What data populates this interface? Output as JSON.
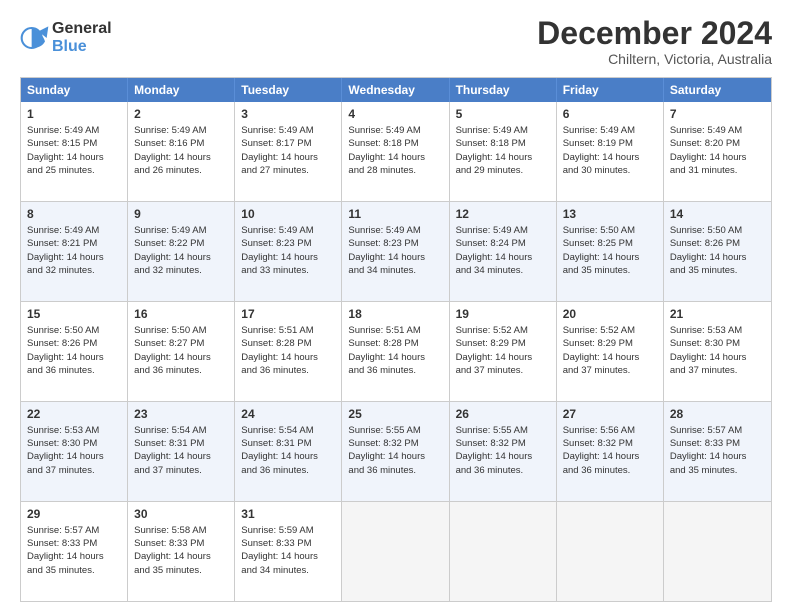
{
  "logo": {
    "general": "General",
    "blue": "Blue"
  },
  "title": "December 2024",
  "location": "Chiltern, Victoria, Australia",
  "days_of_week": [
    "Sunday",
    "Monday",
    "Tuesday",
    "Wednesday",
    "Thursday",
    "Friday",
    "Saturday"
  ],
  "weeks": [
    [
      {
        "day": "1",
        "sunrise": "Sunrise: 5:49 AM",
        "sunset": "Sunset: 8:15 PM",
        "daylight": "Daylight: 14 hours and 25 minutes."
      },
      {
        "day": "2",
        "sunrise": "Sunrise: 5:49 AM",
        "sunset": "Sunset: 8:16 PM",
        "daylight": "Daylight: 14 hours and 26 minutes."
      },
      {
        "day": "3",
        "sunrise": "Sunrise: 5:49 AM",
        "sunset": "Sunset: 8:17 PM",
        "daylight": "Daylight: 14 hours and 27 minutes."
      },
      {
        "day": "4",
        "sunrise": "Sunrise: 5:49 AM",
        "sunset": "Sunset: 8:18 PM",
        "daylight": "Daylight: 14 hours and 28 minutes."
      },
      {
        "day": "5",
        "sunrise": "Sunrise: 5:49 AM",
        "sunset": "Sunset: 8:18 PM",
        "daylight": "Daylight: 14 hours and 29 minutes."
      },
      {
        "day": "6",
        "sunrise": "Sunrise: 5:49 AM",
        "sunset": "Sunset: 8:19 PM",
        "daylight": "Daylight: 14 hours and 30 minutes."
      },
      {
        "day": "7",
        "sunrise": "Sunrise: 5:49 AM",
        "sunset": "Sunset: 8:20 PM",
        "daylight": "Daylight: 14 hours and 31 minutes."
      }
    ],
    [
      {
        "day": "8",
        "sunrise": "Sunrise: 5:49 AM",
        "sunset": "Sunset: 8:21 PM",
        "daylight": "Daylight: 14 hours and 32 minutes."
      },
      {
        "day": "9",
        "sunrise": "Sunrise: 5:49 AM",
        "sunset": "Sunset: 8:22 PM",
        "daylight": "Daylight: 14 hours and 32 minutes."
      },
      {
        "day": "10",
        "sunrise": "Sunrise: 5:49 AM",
        "sunset": "Sunset: 8:23 PM",
        "daylight": "Daylight: 14 hours and 33 minutes."
      },
      {
        "day": "11",
        "sunrise": "Sunrise: 5:49 AM",
        "sunset": "Sunset: 8:23 PM",
        "daylight": "Daylight: 14 hours and 34 minutes."
      },
      {
        "day": "12",
        "sunrise": "Sunrise: 5:49 AM",
        "sunset": "Sunset: 8:24 PM",
        "daylight": "Daylight: 14 hours and 34 minutes."
      },
      {
        "day": "13",
        "sunrise": "Sunrise: 5:50 AM",
        "sunset": "Sunset: 8:25 PM",
        "daylight": "Daylight: 14 hours and 35 minutes."
      },
      {
        "day": "14",
        "sunrise": "Sunrise: 5:50 AM",
        "sunset": "Sunset: 8:26 PM",
        "daylight": "Daylight: 14 hours and 35 minutes."
      }
    ],
    [
      {
        "day": "15",
        "sunrise": "Sunrise: 5:50 AM",
        "sunset": "Sunset: 8:26 PM",
        "daylight": "Daylight: 14 hours and 36 minutes."
      },
      {
        "day": "16",
        "sunrise": "Sunrise: 5:50 AM",
        "sunset": "Sunset: 8:27 PM",
        "daylight": "Daylight: 14 hours and 36 minutes."
      },
      {
        "day": "17",
        "sunrise": "Sunrise: 5:51 AM",
        "sunset": "Sunset: 8:28 PM",
        "daylight": "Daylight: 14 hours and 36 minutes."
      },
      {
        "day": "18",
        "sunrise": "Sunrise: 5:51 AM",
        "sunset": "Sunset: 8:28 PM",
        "daylight": "Daylight: 14 hours and 36 minutes."
      },
      {
        "day": "19",
        "sunrise": "Sunrise: 5:52 AM",
        "sunset": "Sunset: 8:29 PM",
        "daylight": "Daylight: 14 hours and 37 minutes."
      },
      {
        "day": "20",
        "sunrise": "Sunrise: 5:52 AM",
        "sunset": "Sunset: 8:29 PM",
        "daylight": "Daylight: 14 hours and 37 minutes."
      },
      {
        "day": "21",
        "sunrise": "Sunrise: 5:53 AM",
        "sunset": "Sunset: 8:30 PM",
        "daylight": "Daylight: 14 hours and 37 minutes."
      }
    ],
    [
      {
        "day": "22",
        "sunrise": "Sunrise: 5:53 AM",
        "sunset": "Sunset: 8:30 PM",
        "daylight": "Daylight: 14 hours and 37 minutes."
      },
      {
        "day": "23",
        "sunrise": "Sunrise: 5:54 AM",
        "sunset": "Sunset: 8:31 PM",
        "daylight": "Daylight: 14 hours and 37 minutes."
      },
      {
        "day": "24",
        "sunrise": "Sunrise: 5:54 AM",
        "sunset": "Sunset: 8:31 PM",
        "daylight": "Daylight: 14 hours and 36 minutes."
      },
      {
        "day": "25",
        "sunrise": "Sunrise: 5:55 AM",
        "sunset": "Sunset: 8:32 PM",
        "daylight": "Daylight: 14 hours and 36 minutes."
      },
      {
        "day": "26",
        "sunrise": "Sunrise: 5:55 AM",
        "sunset": "Sunset: 8:32 PM",
        "daylight": "Daylight: 14 hours and 36 minutes."
      },
      {
        "day": "27",
        "sunrise": "Sunrise: 5:56 AM",
        "sunset": "Sunset: 8:32 PM",
        "daylight": "Daylight: 14 hours and 36 minutes."
      },
      {
        "day": "28",
        "sunrise": "Sunrise: 5:57 AM",
        "sunset": "Sunset: 8:33 PM",
        "daylight": "Daylight: 14 hours and 35 minutes."
      }
    ],
    [
      {
        "day": "29",
        "sunrise": "Sunrise: 5:57 AM",
        "sunset": "Sunset: 8:33 PM",
        "daylight": "Daylight: 14 hours and 35 minutes."
      },
      {
        "day": "30",
        "sunrise": "Sunrise: 5:58 AM",
        "sunset": "Sunset: 8:33 PM",
        "daylight": "Daylight: 14 hours and 35 minutes."
      },
      {
        "day": "31",
        "sunrise": "Sunrise: 5:59 AM",
        "sunset": "Sunset: 8:33 PM",
        "daylight": "Daylight: 14 hours and 34 minutes."
      },
      {
        "day": "",
        "sunrise": "",
        "sunset": "",
        "daylight": ""
      },
      {
        "day": "",
        "sunrise": "",
        "sunset": "",
        "daylight": ""
      },
      {
        "day": "",
        "sunrise": "",
        "sunset": "",
        "daylight": ""
      },
      {
        "day": "",
        "sunrise": "",
        "sunset": "",
        "daylight": ""
      }
    ]
  ]
}
